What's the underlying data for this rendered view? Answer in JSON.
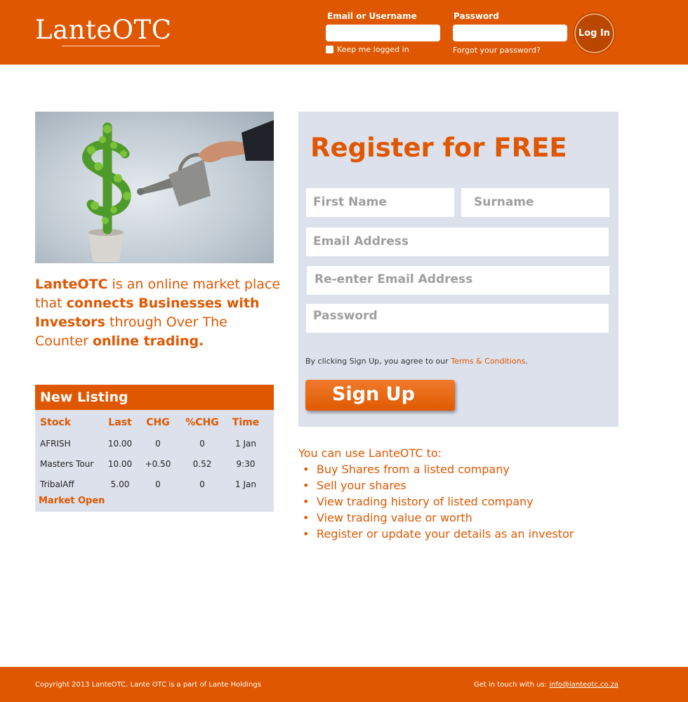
{
  "header": {
    "logo": "LanteOTC",
    "email_label": "Email or Username",
    "password_label": "Password",
    "keep_logged_in": "Keep me logged in",
    "forgot_password": "Forgot your password?",
    "login_button": "Log In"
  },
  "intro": {
    "brand": "LanteOTC",
    "text1": " is an online market place that ",
    "bold1": "connects Businesses with Investors",
    "text2": " through Over The Counter ",
    "bold2": "online trading."
  },
  "listing": {
    "title": "New Listing",
    "columns": [
      "Stock",
      "Last",
      "CHG",
      "%CHG",
      "Time"
    ],
    "rows": [
      [
        "AFRISH",
        "10.00",
        "0",
        "0",
        "1 Jan"
      ],
      [
        "Masters Tour",
        "10.00",
        "+0.50",
        "0.52",
        "9:30"
      ],
      [
        "TribalAff",
        "5.00",
        "0",
        "0",
        "1 Jan"
      ]
    ],
    "status": "Market Open"
  },
  "register": {
    "title": "Register for FREE",
    "first_name": "First Name",
    "surname": "Surname",
    "email": "Email Address",
    "reenter_email": "Re-enter Email Address",
    "password": "Password",
    "agree_text": "By clicking Sign Up, you agree to our ",
    "terms_link": "Terms & Conditions",
    "agree_end": ".",
    "signup_button": "Sign Up"
  },
  "uses": {
    "heading": "You can use LanteOTC to:",
    "items": [
      "Buy Shares from a listed company",
      "Sell your shares",
      "View trading history of listed company",
      "View trading value or worth",
      "Register or update your details as an investor"
    ]
  },
  "footer": {
    "copyright": "Copyright 2013 LanteOTC. Lante OTC is a part of Lante Holdings",
    "contact_label": "Get in touch with us: ",
    "contact_email": "info@lanteotc.co.za"
  },
  "colors": {
    "brand_orange": "#df5700",
    "panel_bg": "#dde1ec",
    "placeholder_grey": "#9e9e9e"
  },
  "icons": {
    "hero_image": "money-tree-watering-can-image"
  }
}
